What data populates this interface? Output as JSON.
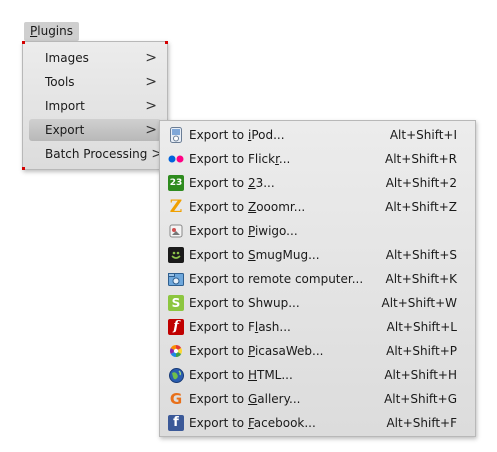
{
  "menubar": {
    "plugins_prefix": "P",
    "plugins_rest": "lugins"
  },
  "plugins_menu": {
    "items": [
      {
        "label": "Images",
        "arrow": ">"
      },
      {
        "label": "Tools",
        "arrow": ">"
      },
      {
        "label": "Import",
        "arrow": ">"
      },
      {
        "label": "Export",
        "arrow": ">"
      },
      {
        "label": "Batch Processing",
        "arrow": ">"
      }
    ]
  },
  "export_menu": {
    "items": [
      {
        "pre": "Export to ",
        "u": "i",
        "post": "Pod...",
        "shortcut": "Alt+Shift+I",
        "icon": "ipod-icon"
      },
      {
        "pre": "Export to Flick",
        "u": "r",
        "post": "...",
        "shortcut": "Alt+Shift+R",
        "icon": "flickr-icon"
      },
      {
        "pre": "Export to ",
        "u": "2",
        "post": "3...",
        "shortcut": "Alt+Shift+2",
        "icon": "23-icon",
        "icon_text": "23"
      },
      {
        "pre": "Export to ",
        "u": "Z",
        "post": "ooomr...",
        "shortcut": "Alt+Shift+Z",
        "icon": "zooomr-icon",
        "icon_text": "Z"
      },
      {
        "pre": "Export to ",
        "u": "P",
        "post": "iwigo...",
        "shortcut": "",
        "icon": "piwigo-icon"
      },
      {
        "pre": "Export to ",
        "u": "S",
        "post": "mugMug...",
        "shortcut": "Alt+Shift+S",
        "icon": "smugmug-icon"
      },
      {
        "pre": "Export to remote computer...",
        "u": "",
        "post": "",
        "shortcut": "Alt+Shift+K",
        "icon": "remote-computer-icon"
      },
      {
        "pre": "Export to Shwup...",
        "u": "",
        "post": "",
        "shortcut": "Alt+Shift+W",
        "icon": "shwup-icon",
        "icon_text": "S"
      },
      {
        "pre": "Export to F",
        "u": "l",
        "post": "ash...",
        "shortcut": "Alt+Shift+L",
        "icon": "flash-icon",
        "icon_text": "f"
      },
      {
        "pre": "Export to ",
        "u": "P",
        "post": "icasaWeb...",
        "shortcut": "Alt+Shift+P",
        "icon": "picasaweb-icon"
      },
      {
        "pre": "Export to ",
        "u": "H",
        "post": "TML...",
        "shortcut": "Alt+Shift+H",
        "icon": "html-icon"
      },
      {
        "pre": "Export to ",
        "u": "G",
        "post": "allery...",
        "shortcut": "Alt+Shift+G",
        "icon": "gallery-icon",
        "icon_text": "G"
      },
      {
        "pre": "Export to ",
        "u": "F",
        "post": "acebook...",
        "shortcut": "Alt+Shift+F",
        "icon": "facebook-icon",
        "icon_text": "f"
      }
    ]
  },
  "colors": {
    "highlight": "#c4c4c4",
    "flickr_blue": "#0063dc",
    "flickr_pink": "#ff0084",
    "green_23": "#2e8b1e",
    "zooomr_orange": "#f0a000",
    "shwup_green": "#8cc63f",
    "flash_red": "#c00000",
    "facebook_blue": "#3b5998",
    "gallery_orange": "#e8701a"
  }
}
